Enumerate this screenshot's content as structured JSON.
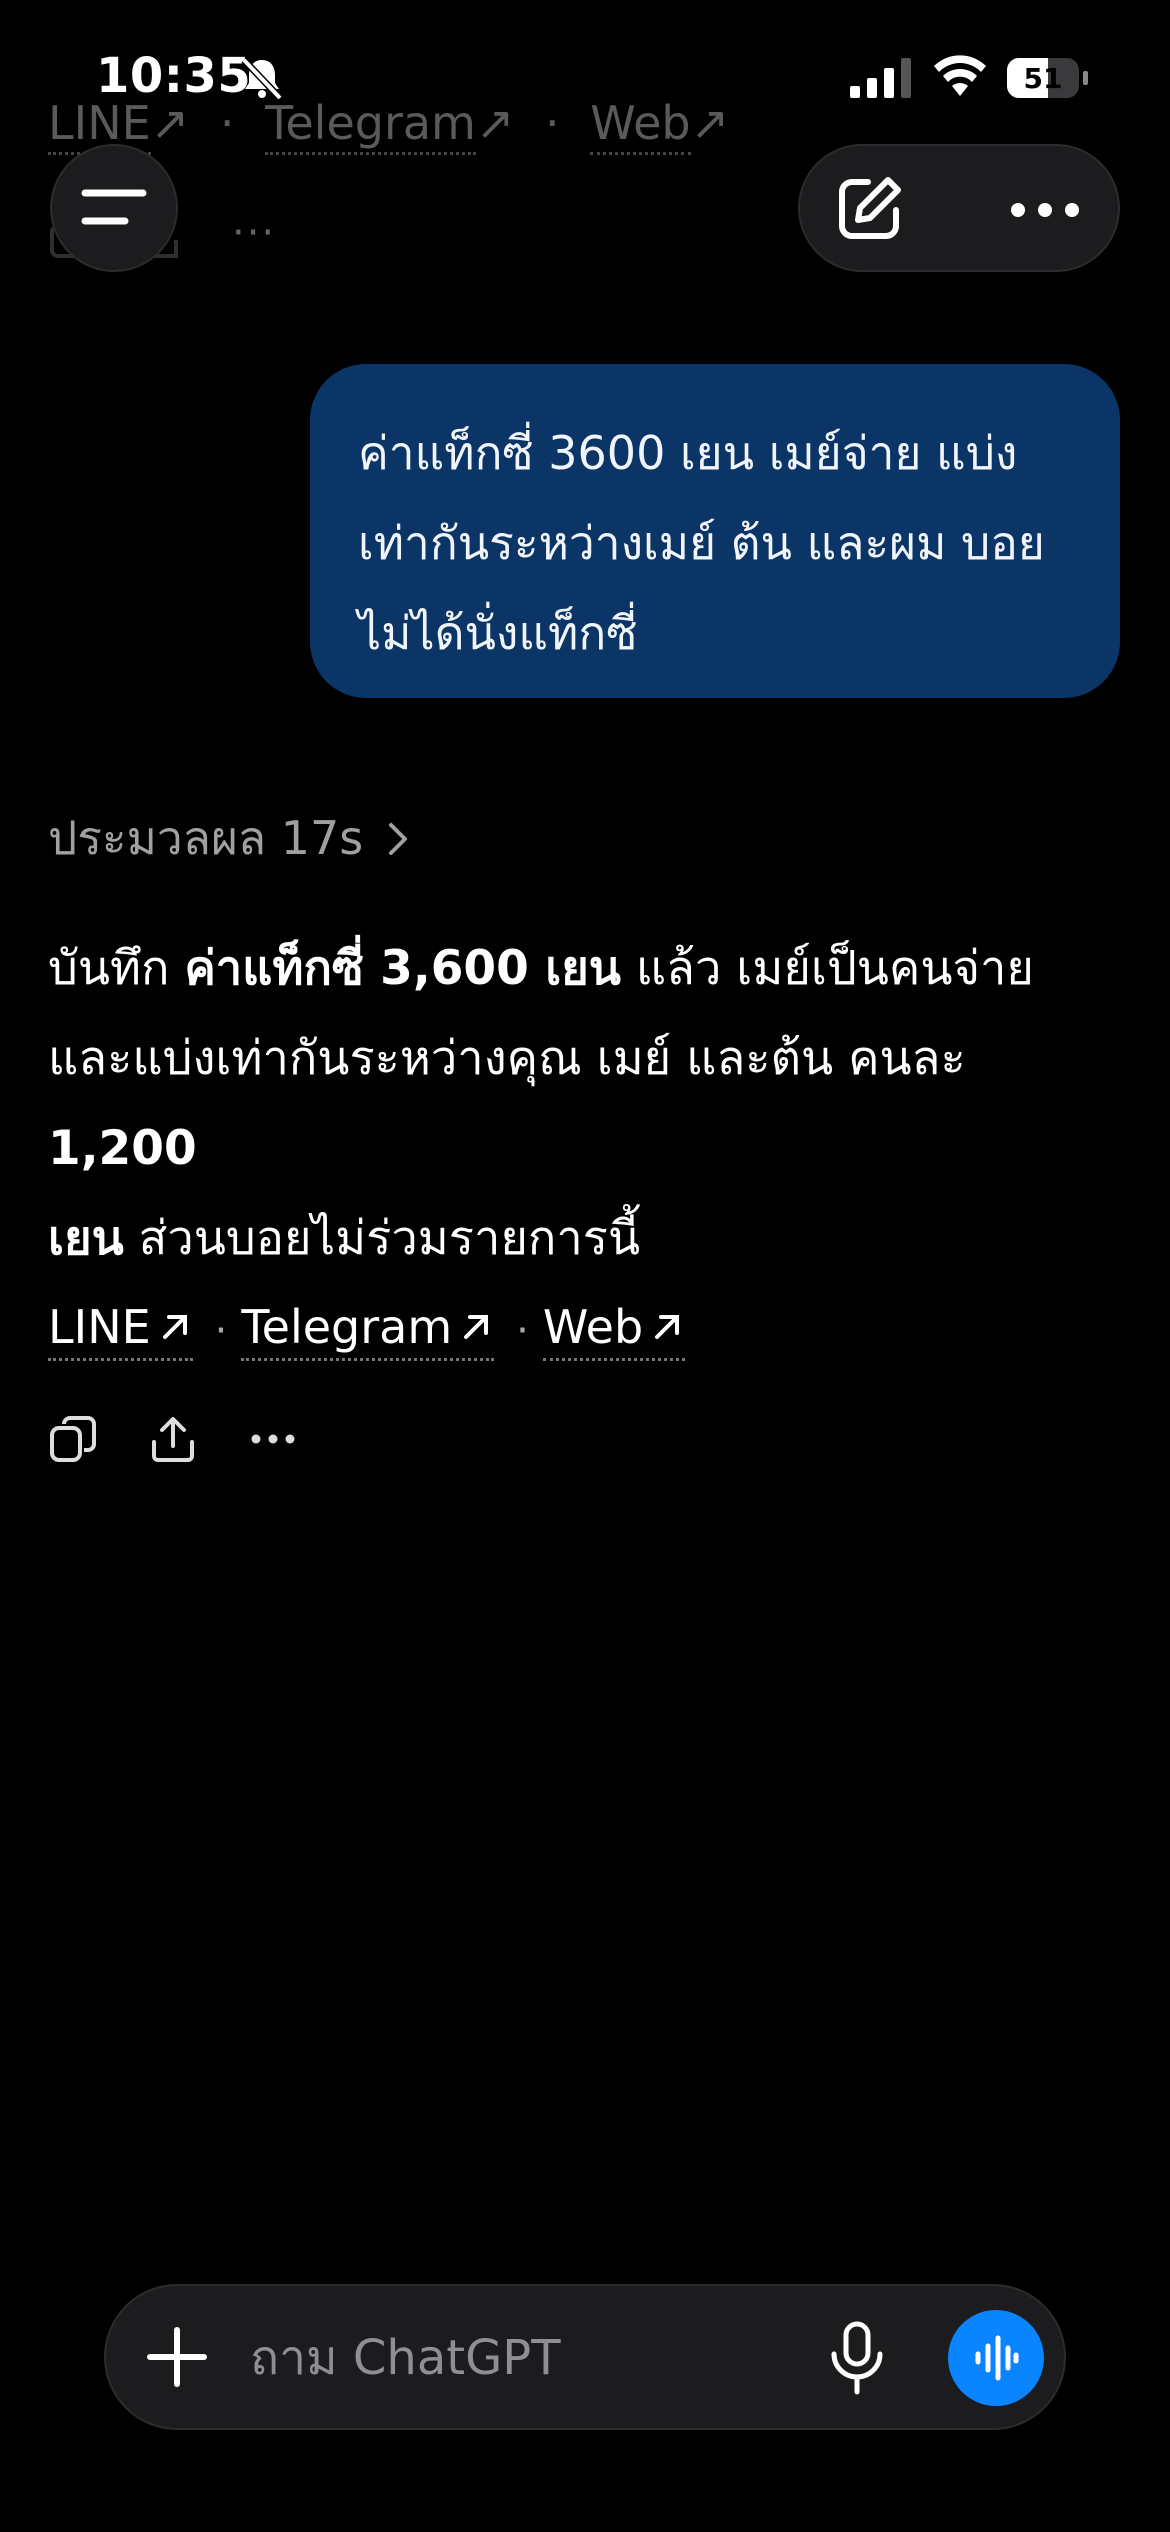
{
  "status_bar": {
    "time": "10:35",
    "battery": "51"
  },
  "ghost_links": [
    "LINE",
    "Telegram",
    "Web"
  ],
  "ghost_more": "···",
  "user_message": {
    "lines": [
      "ค่าแท็กซี่ 3600 เยน เมย์จ่าย แบ่ง",
      "เท่ากันระหว่างเมย์ ต้น และผม บอย",
      "ไม่ได้นั่งแท็กซี่"
    ]
  },
  "thinking": {
    "label": "ประมวลผล 17s"
  },
  "assistant": {
    "p1_a": "บันทึก ",
    "p1_b": "ค่าแท็กซี่ 3,600 เยน",
    "p1_c": " แล้ว เมย์เป็นคนจ่าย",
    "p2_a": "และแบ่งเท่ากันระหว่างคุณ เมย์ และต้น คนละ ",
    "p2_b": "1,200",
    "p3_b": "เยน",
    "p3_c": " ส่วนบอยไม่ร่วมรายการนี้"
  },
  "links": [
    {
      "label": "LINE"
    },
    {
      "label": "Telegram"
    },
    {
      "label": "Web"
    }
  ],
  "links_separator": "·",
  "composer": {
    "placeholder": "ถาม ChatGPT"
  },
  "colors": {
    "bubble": "#0b3566",
    "accent": "#0a84ff",
    "background": "#000000"
  }
}
